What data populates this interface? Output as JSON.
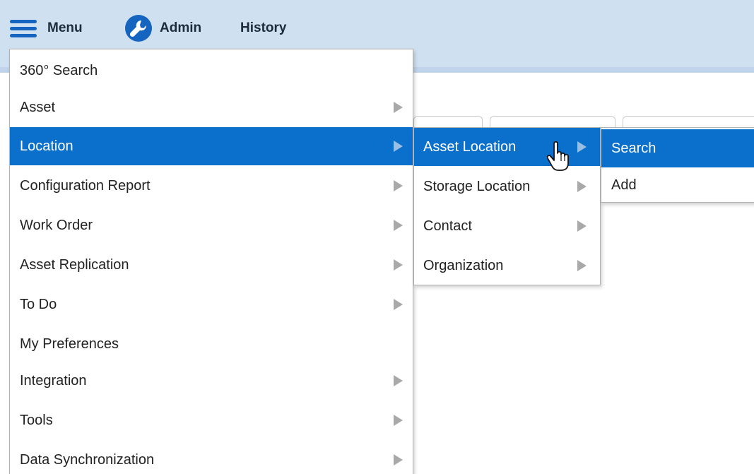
{
  "topbar": {
    "menu_label": "Menu",
    "admin_label": "Admin",
    "history_label": "History"
  },
  "main_menu": {
    "items": [
      {
        "label": "360° Search",
        "has_submenu": false
      },
      {
        "label": "Asset",
        "has_submenu": true
      },
      {
        "label": "Location",
        "has_submenu": true,
        "active": true
      },
      {
        "label": "Configuration Report",
        "has_submenu": true
      },
      {
        "label": "Work Order",
        "has_submenu": true
      },
      {
        "label": "Asset Replication",
        "has_submenu": true
      },
      {
        "label": "To Do",
        "has_submenu": true
      },
      {
        "label": "My Preferences",
        "has_submenu": false
      },
      {
        "label": "Integration",
        "has_submenu": true
      },
      {
        "label": "Tools",
        "has_submenu": true
      },
      {
        "label": "Data Synchronization",
        "has_submenu": true
      }
    ]
  },
  "location_submenu": {
    "items": [
      {
        "label": "Asset Location",
        "has_submenu": true,
        "active": true
      },
      {
        "label": "Storage Location",
        "has_submenu": true
      },
      {
        "label": "Contact",
        "has_submenu": true
      },
      {
        "label": "Organization",
        "has_submenu": true
      }
    ]
  },
  "asset_location_submenu": {
    "items": [
      {
        "label": "Search",
        "active": true
      },
      {
        "label": "Add"
      }
    ]
  },
  "colors": {
    "topbar": "#cfe0f1",
    "highlight": "#0b6fcc",
    "icon_blue": "#1565c0"
  },
  "icons": {
    "menu": "hamburger-icon",
    "admin": "wrench-icon",
    "submenu": "chevron-right-icon",
    "cursor": "hand-pointer-icon"
  }
}
